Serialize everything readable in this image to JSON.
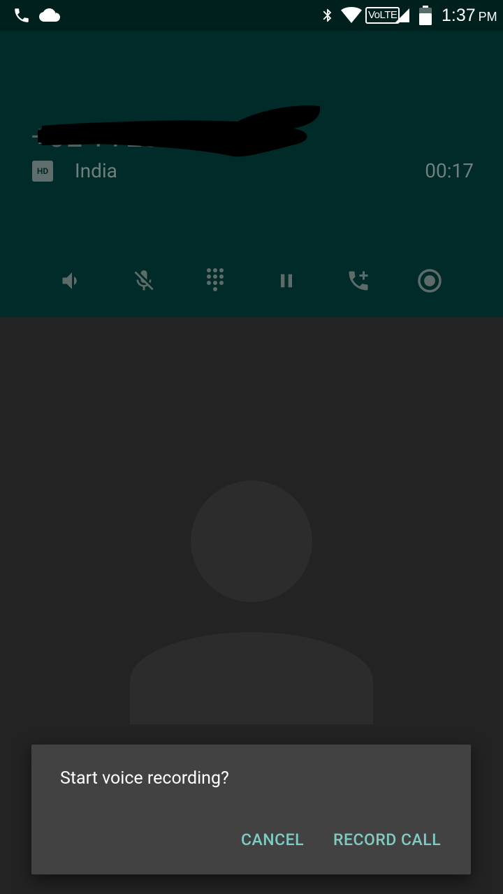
{
  "status_bar": {
    "time": "1:37",
    "ampm": "PM",
    "network_label": "VoLTE",
    "icons": [
      "phone-icon",
      "cloud-icon",
      "bluetooth-icon",
      "wifi-icon",
      "volte-icon",
      "signal-icon",
      "battery-icon"
    ]
  },
  "call": {
    "location": "India",
    "timer": "00:17",
    "hd_label": "HD",
    "controls": [
      "speaker-icon",
      "mute-icon",
      "dialpad-icon",
      "hold-icon",
      "add-call-icon",
      "record-icon"
    ]
  },
  "dialog": {
    "message": "Start voice recording?",
    "cancel_label": "CANCEL",
    "confirm_label": "RECORD CALL"
  },
  "colors": {
    "header_bg": "#002b28",
    "status_bg": "#00201d",
    "body_bg": "#232323",
    "accent": "#80cbc4",
    "dialog_bg": "#424242"
  }
}
